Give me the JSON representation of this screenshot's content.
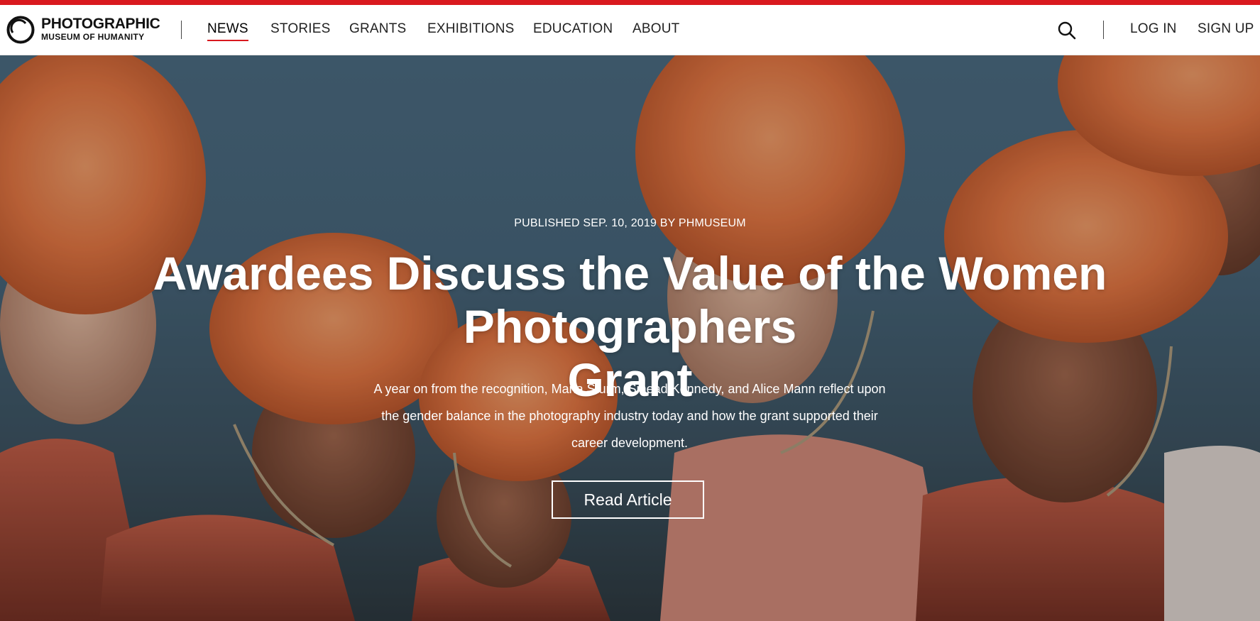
{
  "brand": {
    "line1": "PHOTOGRAPHIC",
    "line2": "MUSEUM OF HUMANITY",
    "accent_color": "#d9191f"
  },
  "nav": {
    "items": [
      {
        "label": "NEWS",
        "active": true
      },
      {
        "label": "STORIES",
        "active": false
      },
      {
        "label": "GRANTS",
        "active": false
      },
      {
        "label": "EXHIBITIONS",
        "active": false
      },
      {
        "label": "EDUCATION",
        "active": false
      },
      {
        "label": "ABOUT",
        "active": false
      }
    ]
  },
  "header_right": {
    "search_icon": "search-icon",
    "login_label": "LOG IN",
    "signup_label": "SIGN UP"
  },
  "hero": {
    "meta": "PUBLISHED SEP. 10, 2019 BY PHMUSEUM",
    "title_line1": "Awardees Discuss the Value of the Women Photographers",
    "title_line2": "Grant",
    "summary": "A year on from the recognition, Maria Sturm, Sinead Kennedy, and Alice Mann reflect upon the gender balance in the photography industry today and how the grant supported their career development.",
    "cta_label": "Read Article"
  }
}
